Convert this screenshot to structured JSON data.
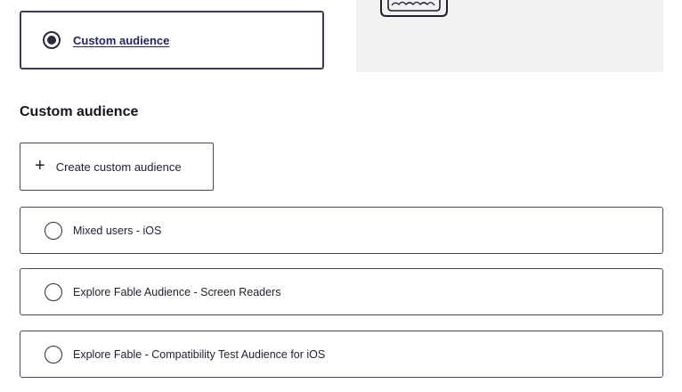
{
  "selected_option": {
    "label": "Custom audience",
    "checked": true
  },
  "illustration": {
    "icon": "keyboard-illustration-icon"
  },
  "section": {
    "title": "Custom audience"
  },
  "create_button": {
    "icon": "plus-icon",
    "label": "Create custom audience"
  },
  "audiences": [
    {
      "label": "Mixed users - iOS",
      "checked": false
    },
    {
      "label": "Explore Fable Audience - Screen Readers",
      "checked": false
    },
    {
      "label": "Explore Fable - Compatibility Test Audience for iOS",
      "checked": false
    }
  ],
  "colors": {
    "border_dark": "#3a3a52",
    "link": "#24245c",
    "panel_bg": "#f1f1f1"
  }
}
